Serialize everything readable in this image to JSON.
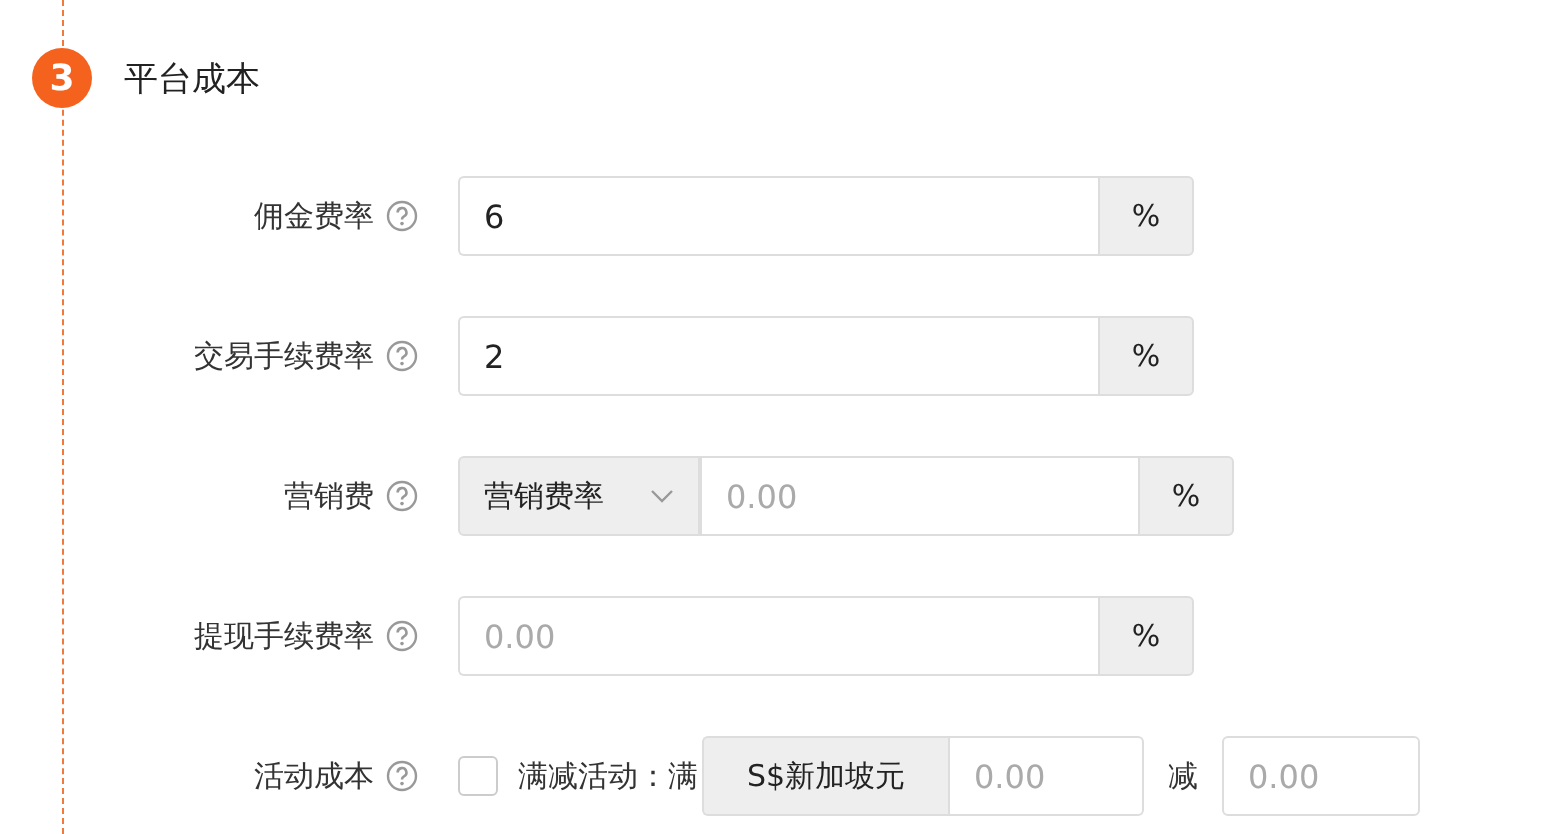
{
  "step": {
    "number": "3",
    "title": "平台成本"
  },
  "rows": [
    {
      "kind": "input",
      "label": "佣金费率",
      "value": "6",
      "suffix": "%"
    },
    {
      "kind": "input",
      "label": "交易手续费率",
      "value": "2",
      "suffix": "%"
    },
    {
      "kind": "select-input",
      "label": "营销费",
      "select": "营销费率",
      "placeholder": "0.00",
      "suffix": "%"
    },
    {
      "kind": "input",
      "label": "提现手续费率",
      "placeholder": "0.00",
      "suffix": "%"
    },
    {
      "kind": "activity",
      "label": "活动成本",
      "checked": false,
      "text": "满减活动：满",
      "prefix": "S$新加坡元",
      "placeholder": "0.00",
      "joiner": "减",
      "placeholder2": "0.00"
    }
  ]
}
